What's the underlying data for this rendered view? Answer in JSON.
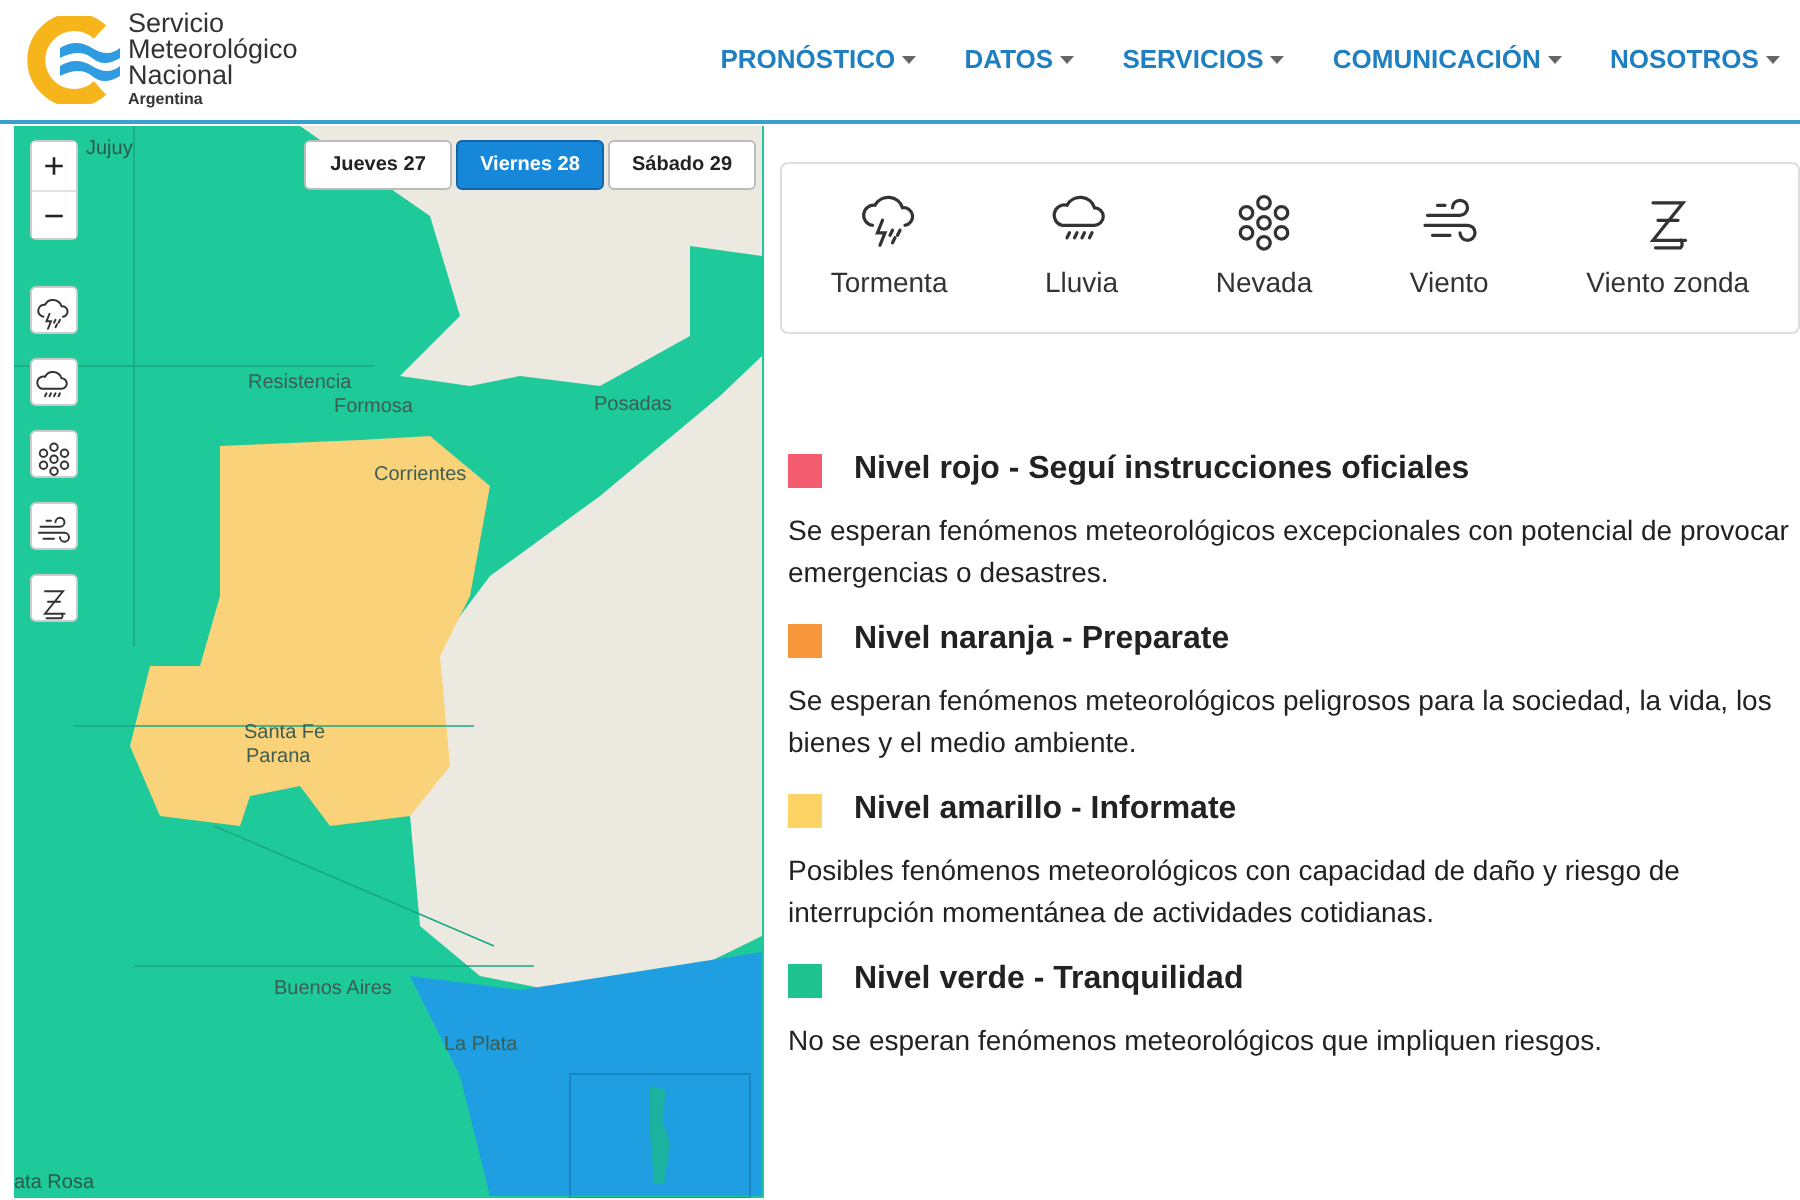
{
  "brand": {
    "name_lines": [
      "Servicio",
      "Meteorológico",
      "Nacional"
    ],
    "country": "Argentina"
  },
  "nav": [
    {
      "label": "PRONÓSTICO"
    },
    {
      "label": "DATOS"
    },
    {
      "label": "SERVICIOS"
    },
    {
      "label": "COMUNICACIÓN"
    },
    {
      "label": "NOSOTROS"
    }
  ],
  "map": {
    "day_tabs": [
      {
        "label": "Jueves 27",
        "selected": false
      },
      {
        "label": "Viernes 28",
        "selected": true
      },
      {
        "label": "Sábado 29",
        "selected": false
      }
    ],
    "zoom_in": "+",
    "zoom_out": "−",
    "layers": [
      {
        "kind": "storm"
      },
      {
        "kind": "rain"
      },
      {
        "kind": "snow"
      },
      {
        "kind": "wind"
      },
      {
        "kind": "zonda"
      }
    ],
    "labels": [
      {
        "text": "Jujuy",
        "kind": "region"
      },
      {
        "text": "Formosa",
        "kind": "city"
      },
      {
        "text": "Resistencia",
        "kind": "city"
      },
      {
        "text": "Corrientes",
        "kind": "city"
      },
      {
        "text": "Posadas",
        "kind": "city"
      },
      {
        "text": "Santa Fe",
        "kind": "city"
      },
      {
        "text": "Parana",
        "kind": "city"
      },
      {
        "text": "Buenos Aires",
        "kind": "city"
      },
      {
        "text": "La Plata",
        "kind": "city"
      },
      {
        "text": "ata Rosa",
        "kind": "region"
      }
    ]
  },
  "phenomena": [
    {
      "kind": "storm",
      "label": "Tormenta"
    },
    {
      "kind": "rain",
      "label": "Lluvia"
    },
    {
      "kind": "snow",
      "label": "Nevada"
    },
    {
      "kind": "wind",
      "label": "Viento"
    },
    {
      "kind": "zonda",
      "label": "Viento zonda"
    }
  ],
  "levels": [
    {
      "title": "Nivel rojo - Seguí instrucciones oficiales",
      "color": "#f25c6e",
      "text": "Se esperan fenómenos meteorológicos excepcionales con potencial de provocar emergencias o desastres."
    },
    {
      "title": "Nivel naranja - Preparate",
      "color": "#f7963b",
      "text": "Se esperan fenómenos meteorológicos peligrosos para la sociedad, la vida, los bienes y el medio ambiente."
    },
    {
      "title": "Nivel amarillo - Informate",
      "color": "#fdd365",
      "text": "Posibles fenómenos meteorológicos con capacidad de daño y riesgo de interrupción momentánea de actividades cotidianas."
    },
    {
      "title": "Nivel verde - Tranquilidad",
      "color": "#1ec48f",
      "text": "No se esperan fenómenos meteorológicos que impliquen riesgos."
    }
  ]
}
